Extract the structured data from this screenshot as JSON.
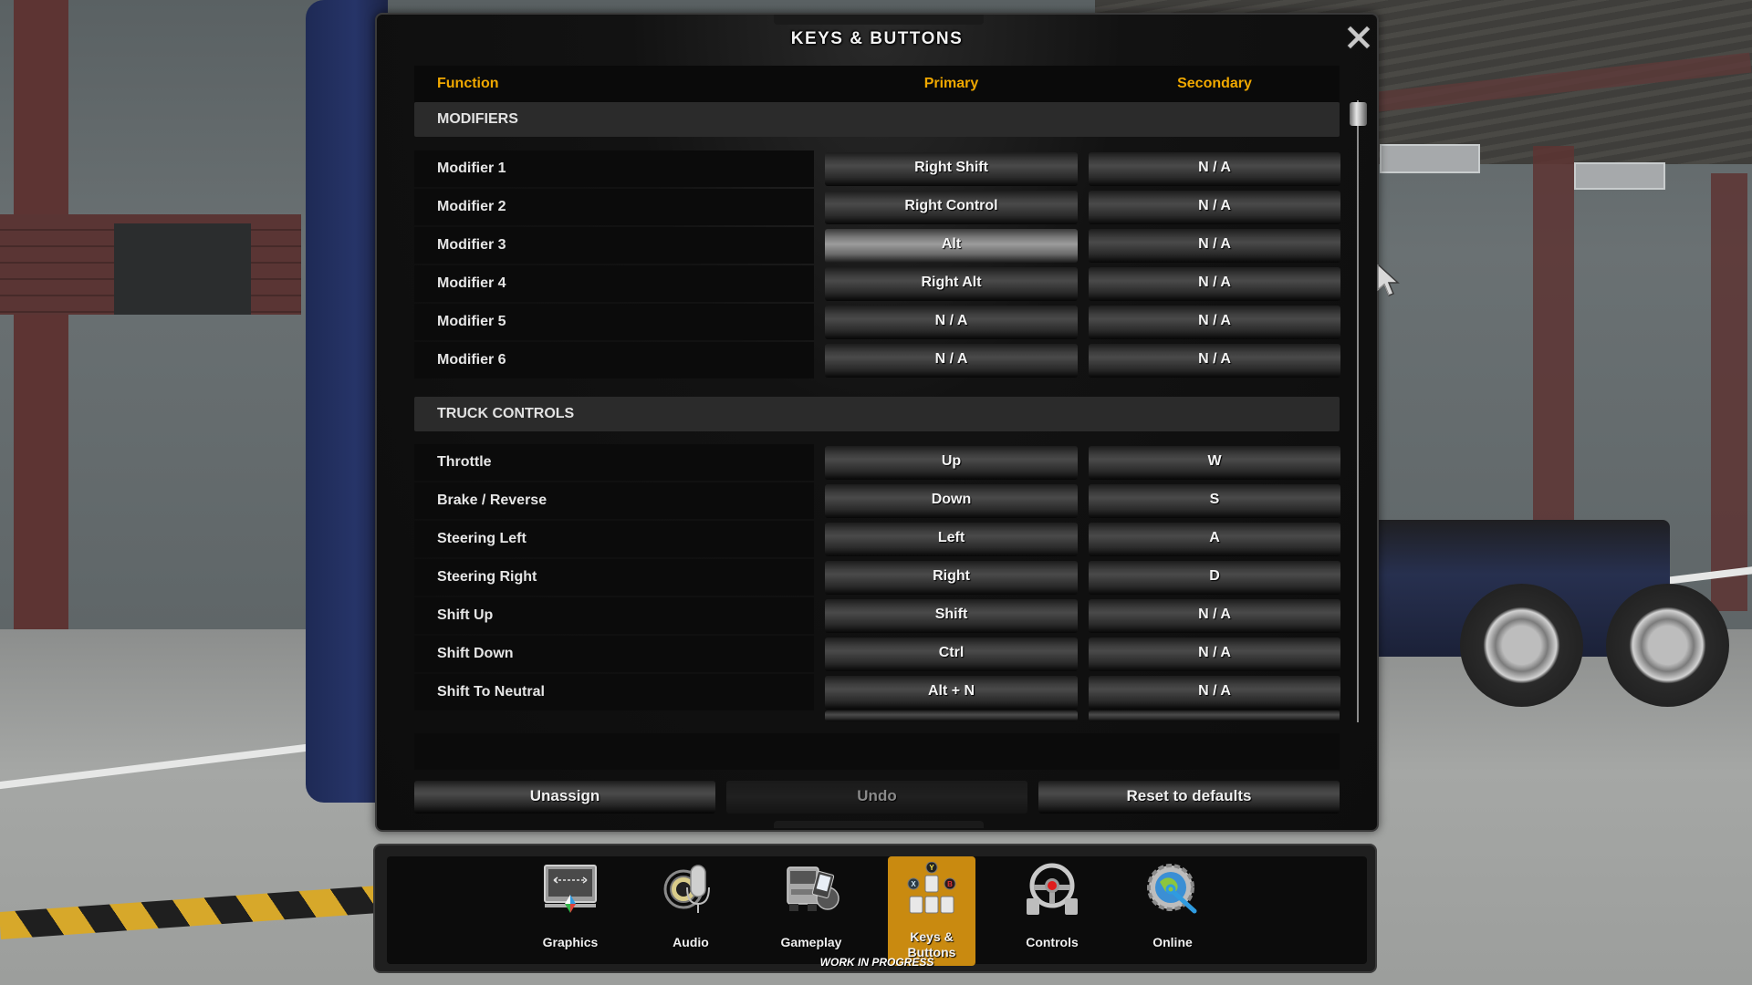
{
  "dialog": {
    "title": "KEYS & BUTTONS",
    "close_icon": "close-x-icon"
  },
  "columns": {
    "function": "Function",
    "primary": "Primary",
    "secondary": "Secondary"
  },
  "sections": [
    {
      "title": "MODIFIERS",
      "rows": [
        {
          "function": "Modifier 1",
          "primary": "Right Shift",
          "secondary": "N / A"
        },
        {
          "function": "Modifier 2",
          "primary": "Right Control",
          "secondary": "N / A"
        },
        {
          "function": "Modifier 3",
          "primary": "Alt",
          "secondary": "N / A"
        },
        {
          "function": "Modifier 4",
          "primary": "Right Alt",
          "secondary": "N / A"
        },
        {
          "function": "Modifier 5",
          "primary": "N / A",
          "secondary": "N / A"
        },
        {
          "function": "Modifier 6",
          "primary": "N / A",
          "secondary": "N / A"
        }
      ]
    },
    {
      "title": "TRUCK CONTROLS",
      "rows": [
        {
          "function": "Throttle",
          "primary": "Up",
          "secondary": "W"
        },
        {
          "function": "Brake / Reverse",
          "primary": "Down",
          "secondary": "S"
        },
        {
          "function": "Steering Left",
          "primary": "Left",
          "secondary": "A"
        },
        {
          "function": "Steering Right",
          "primary": "Right",
          "secondary": "D"
        },
        {
          "function": "Shift Up",
          "primary": "Shift",
          "secondary": "N / A"
        },
        {
          "function": "Shift Down",
          "primary": "Ctrl",
          "secondary": "N / A"
        },
        {
          "function": "Shift To Neutral",
          "primary": "Alt + N",
          "secondary": "N / A"
        }
      ]
    }
  ],
  "hovered_binding": {
    "section": 0,
    "row": 2,
    "column": "primary"
  },
  "actions": {
    "unassign": "Unassign",
    "undo": "Undo",
    "undo_enabled": false,
    "reset": "Reset to defaults"
  },
  "nav": {
    "items": [
      {
        "label": "Graphics",
        "icon": "monitor-icon",
        "active": false
      },
      {
        "label": "Audio",
        "icon": "microphone-speaker-icon",
        "active": false
      },
      {
        "label": "Gameplay",
        "icon": "truck-pda-icon",
        "active": false
      },
      {
        "label": "Keys & Buttons",
        "icon": "keyboard-gamepad-icon",
        "active": true
      },
      {
        "label": "Controls",
        "icon": "steering-wheel-icon",
        "active": false
      },
      {
        "label": "Online",
        "icon": "globe-gear-wrench-icon",
        "active": false
      }
    ],
    "status_text": "WORK IN PROGRESS"
  },
  "colors": {
    "accent_header": "#f0a800",
    "active_tab": "#c98a10"
  }
}
